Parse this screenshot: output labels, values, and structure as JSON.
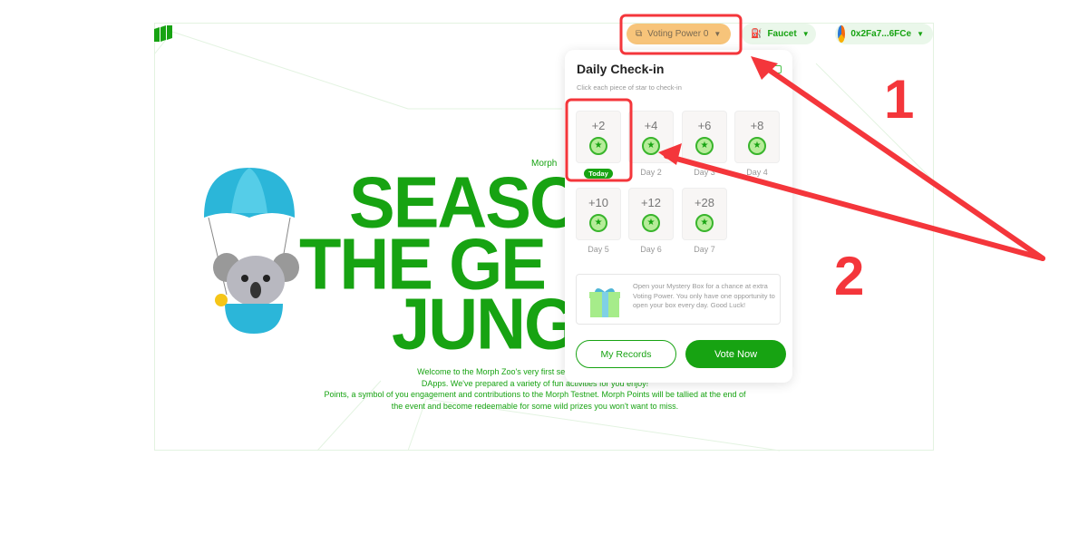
{
  "header": {
    "voting_power": "Voting Power 0",
    "faucet": "Faucet",
    "wallet": "0x2Fa7...6FCe"
  },
  "hero": {
    "eyebrow": "Morph",
    "line1": "SEASO",
    "line2": "THE GE",
    "line3": "JUNG",
    "description": [
      "Welcome to the Morph Zoo's very first season. Enter the Genesis",
      "DApps. We've prepared a variety of fun activities for you enjoy!",
      "Points, a symbol of you engagement and contributions to the Morph Testnet. Morph Points will be tallied at the end of",
      "the event and become redeemable for some wild prizes you won't want to miss."
    ]
  },
  "checkin": {
    "title": "Daily Check-in",
    "subtitle": "Click each piece of star to check-in",
    "today_label": "Today",
    "days": [
      {
        "amount": "+2",
        "label": "Today"
      },
      {
        "amount": "+4",
        "label": "Day 2"
      },
      {
        "amount": "+6",
        "label": "Day 3"
      },
      {
        "amount": "+8",
        "label": "Day 4"
      },
      {
        "amount": "+10",
        "label": "Day 5"
      },
      {
        "amount": "+12",
        "label": "Day 6"
      },
      {
        "amount": "+28",
        "label": "Day 7"
      }
    ],
    "mystery_text": "Open your Mystery Box for a chance at extra Voting Power. You only have one opportunity to open your box every day. Good Luck!",
    "my_records": "My Records",
    "vote_now": "Vote Now"
  },
  "annotations": {
    "n1": "1",
    "n2": "2"
  },
  "colors": {
    "brand": "#17a312",
    "voting_pill": "#f7c47a",
    "annotation": "#f4363b"
  }
}
